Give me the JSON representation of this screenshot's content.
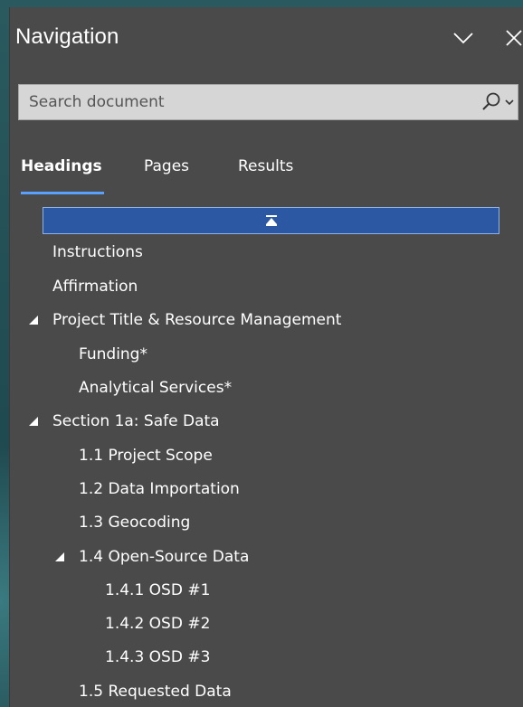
{
  "panel": {
    "title": "Navigation",
    "icons": [
      "chevron-down-icon",
      "close-icon"
    ]
  },
  "search": {
    "placeholder": "Search document",
    "icon": "search-icon"
  },
  "tabs": [
    {
      "label": "Headings",
      "active": true
    },
    {
      "label": "Pages",
      "active": false
    },
    {
      "label": "Results",
      "active": false
    }
  ],
  "collapse_all": {
    "icon": "collapse-all-icon"
  },
  "tree": [
    {
      "label": "Instructions",
      "level": 0,
      "expandable": false
    },
    {
      "label": "Affirmation",
      "level": 0,
      "expandable": false
    },
    {
      "label": "Project Title & Resource Management",
      "level": 0,
      "expandable": true,
      "expanded": true
    },
    {
      "label": "Funding*",
      "level": 1,
      "expandable": false
    },
    {
      "label": "Analytical Services*",
      "level": 1,
      "expandable": false
    },
    {
      "label": "Section 1a: Safe Data",
      "level": 0,
      "expandable": true,
      "expanded": true
    },
    {
      "label": "1.1 Project Scope",
      "level": 1,
      "expandable": false
    },
    {
      "label": "1.2 Data Importation",
      "level": 1,
      "expandable": false
    },
    {
      "label": "1.3 Geocoding",
      "level": 1,
      "expandable": false
    },
    {
      "label": "1.4 Open-Source Data",
      "level": 1,
      "expandable": true,
      "expanded": true
    },
    {
      "label": "1.4.1 OSD #1",
      "level": 2,
      "expandable": false
    },
    {
      "label": "1.4.2 OSD #2",
      "level": 2,
      "expandable": false
    },
    {
      "label": "1.4.3 OSD #3",
      "level": 2,
      "expandable": false
    },
    {
      "label": "1.5 Requested Data",
      "level": 1,
      "expandable": false
    }
  ],
  "colors": {
    "panel_bg": "#4a4a4a",
    "accent": "#5aa0ff",
    "collapse_bar": "#2b57a3",
    "text": "#ffffff"
  }
}
